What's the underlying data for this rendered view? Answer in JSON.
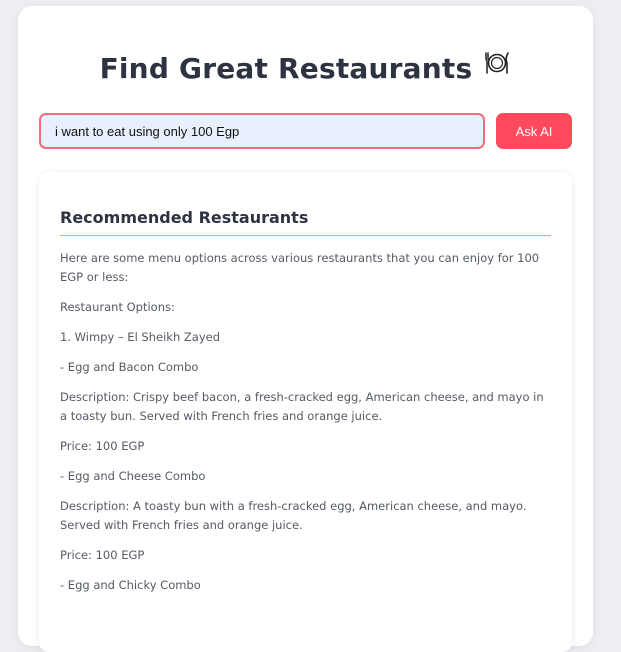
{
  "header": {
    "title": "Find Great Restaurants",
    "icon": "plate-fork-knife-icon"
  },
  "search": {
    "value": "i want to eat using only 100 Egp",
    "button_label": "Ask AI"
  },
  "results": {
    "heading": "Recommended Restaurants",
    "paragraphs": [
      "Here are some menu options across various restaurants that you can enjoy for 100 EGP or less:",
      "Restaurant Options:",
      "1. Wimpy – El Sheikh Zayed",
      "- Egg and Bacon Combo",
      "Description: Crispy beef bacon, a fresh-cracked egg, American cheese, and mayo in a toasty bun. Served with French fries and orange juice.",
      "Price: 100 EGP",
      "- Egg and Cheese Combo",
      "Description: A toasty bun with a fresh-cracked egg, American cheese, and mayo. Served with French fries and orange juice.",
      "Price: 100 EGP",
      "- Egg and Chicky Combo"
    ]
  },
  "colors": {
    "accent": "#ff4a5e",
    "input_border": "#f06b7d",
    "input_bg": "#e8f0fe",
    "heading_underline": "#f0a84a"
  }
}
